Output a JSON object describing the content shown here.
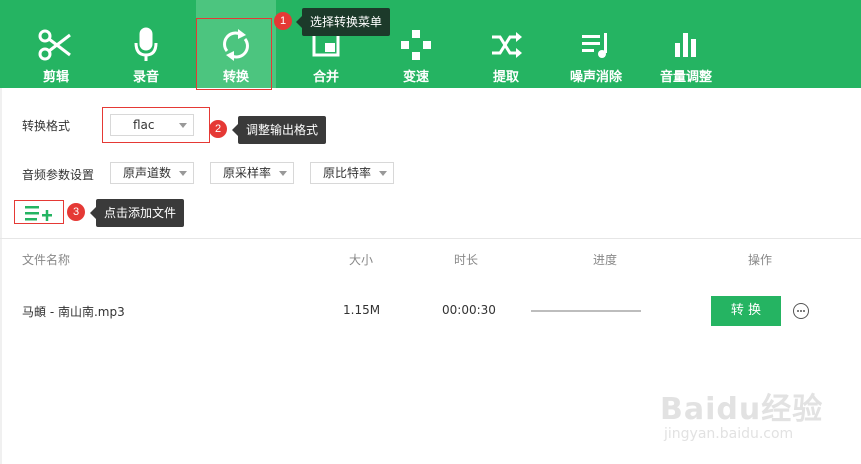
{
  "toolbar": {
    "items": [
      {
        "label": "剪辑",
        "icon": "scissors-icon"
      },
      {
        "label": "录音",
        "icon": "microphone-icon"
      },
      {
        "label": "转换",
        "icon": "convert-icon",
        "active": true
      },
      {
        "label": "合并",
        "icon": "merge-icon"
      },
      {
        "label": "变速",
        "icon": "speed-icon"
      },
      {
        "label": "提取",
        "icon": "shuffle-icon"
      },
      {
        "label": "噪声消除",
        "icon": "noise-icon"
      },
      {
        "label": "音量调整",
        "icon": "volume-bars-icon"
      }
    ]
  },
  "callouts": [
    {
      "num": "1",
      "text": "选择转换菜单"
    },
    {
      "num": "2",
      "text": "调整输出格式"
    },
    {
      "num": "3",
      "text": "点击添加文件"
    }
  ],
  "settings": {
    "format_label": "转换格式",
    "format_value": "flac",
    "params_label": "音频参数设置",
    "channels": "原声道数",
    "sample_rate": "原采样率",
    "bitrate": "原比特率"
  },
  "table": {
    "headers": {
      "name": "文件名称",
      "size": "大小",
      "duration": "时长",
      "progress": "进度",
      "action": "操作"
    },
    "rows": [
      {
        "name": "马頔 - 南山南.mp3",
        "size": "1.15M",
        "duration": "00:00:30",
        "progress": 0,
        "action_label": "转 换"
      }
    ]
  },
  "watermark": {
    "brand": "Baidu经验",
    "url": "jingyan.baidu.com"
  },
  "colors": {
    "brand_green": "#25b462",
    "annotation_red": "#e53935"
  }
}
